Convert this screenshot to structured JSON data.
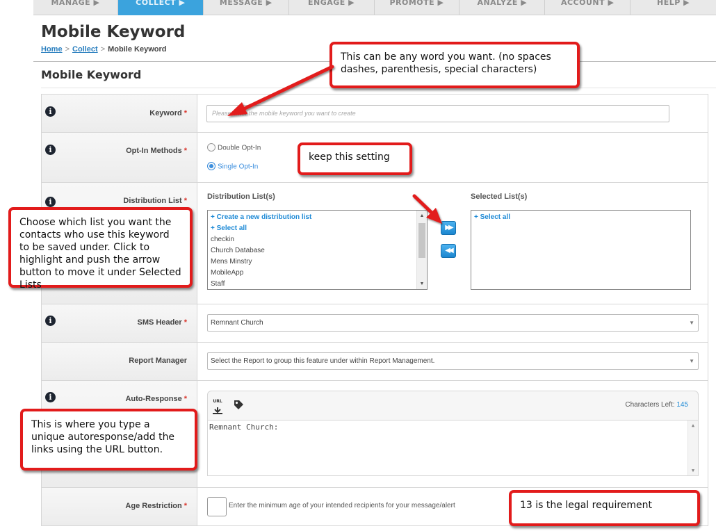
{
  "nav": {
    "tabs": [
      "MANAGE ▶",
      "COLLECT ▶",
      "MESSAGE ▶",
      "ENGAGE ▶",
      "PROMOTE ▶",
      "ANALYZE ▶",
      "ACCOUNT ▶",
      "HELP ▶"
    ],
    "active_index": 1
  },
  "page": {
    "title": "Mobile Keyword",
    "breadcrumb": {
      "home": "Home",
      "sep": ">",
      "collect": "Collect",
      "current": "Mobile Keyword"
    },
    "section_title": "Mobile Keyword"
  },
  "form": {
    "keyword": {
      "label": "Keyword",
      "required": "*",
      "placeholder": "Please enter the mobile keyword you want to create"
    },
    "optin": {
      "label": "Opt-In Methods",
      "required": "*",
      "options": [
        "Double Opt-In",
        "Single Opt-In"
      ],
      "selected": "Single Opt-In"
    },
    "distribution": {
      "label": "Distribution List",
      "required": "*",
      "available_header": "Distribution List(s)",
      "selected_header": "Selected List(s)",
      "available": [
        "+ Create a new distribution list",
        "+ Select all",
        "checkin",
        "Church Database",
        "Mens Minstry",
        "MobileApp",
        "Staff"
      ],
      "selected": [
        "+ Select all"
      ],
      "move_right": "▶▶",
      "move_left": "◀◀"
    },
    "sms_header": {
      "label": "SMS Header",
      "required": "*",
      "value": "Remnant Church"
    },
    "report_manager": {
      "label": "Report Manager",
      "value": "Select the Report to group this feature under within Report Management."
    },
    "auto_response": {
      "label": "Auto-Response",
      "required": "*",
      "url_button": "URL",
      "chars_left_label": "Characters Left:",
      "chars_left": "145",
      "value": "Remnant Church:"
    },
    "age": {
      "label": "Age Restriction",
      "required": "*",
      "hint": "Enter the minimum age of your intended recipients for your message/alert"
    }
  },
  "callouts": {
    "keyword": "This can be any word you want. (no spaces dashes, parenthesis, special characters)",
    "optin": "keep this setting",
    "lists": "Choose which list you want the contacts who use this keyword to be saved under. Click to highlight and push the arrow button to move it under Selected Lists",
    "response": "This is where you type a unique autoresponse/add the links using the URL button.",
    "age": "13 is the legal requirement"
  },
  "icons": {
    "info": "info-icon",
    "select_arrow": "chevron-down-icon",
    "url": "url-icon",
    "tag": "tag-icon"
  },
  "colors": {
    "accent": "#3ba3dd",
    "callout_border": "#e21b1b",
    "link": "#1e8ad6",
    "required": "#d9342b"
  }
}
